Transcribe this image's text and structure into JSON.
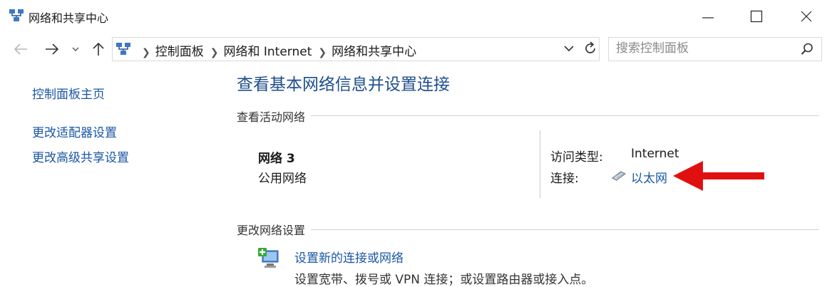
{
  "window": {
    "title": "网络和共享中心",
    "controls": {
      "minimize": "minimize-icon",
      "maximize": "maximize-icon",
      "close": "close-icon"
    }
  },
  "nav": {
    "breadcrumbs": [
      "控制面板",
      "网络和 Internet",
      "网络和共享中心"
    ],
    "search_placeholder": "搜索控制面板"
  },
  "sidebar": {
    "items": [
      "控制面板主页",
      "更改适配器设置",
      "更改高级共享设置"
    ]
  },
  "main": {
    "heading": "查看基本网络信息并设置连接",
    "active_section": "查看活动网络",
    "network": {
      "name": "网络 3",
      "category": "公用网络",
      "access_label": "访问类型:",
      "access_value": "Internet",
      "connections_label": "连接:",
      "connection_name": "以太网"
    },
    "change_section": "更改网络设置",
    "tasks": [
      {
        "title": "设置新的连接或网络",
        "desc": "设置宽带、拨号或 VPN 连接；或设置路由器或接入点。"
      }
    ]
  },
  "colors": {
    "link": "#1a56a6",
    "heading": "#1e4e8c",
    "arrow": "#e11010"
  }
}
